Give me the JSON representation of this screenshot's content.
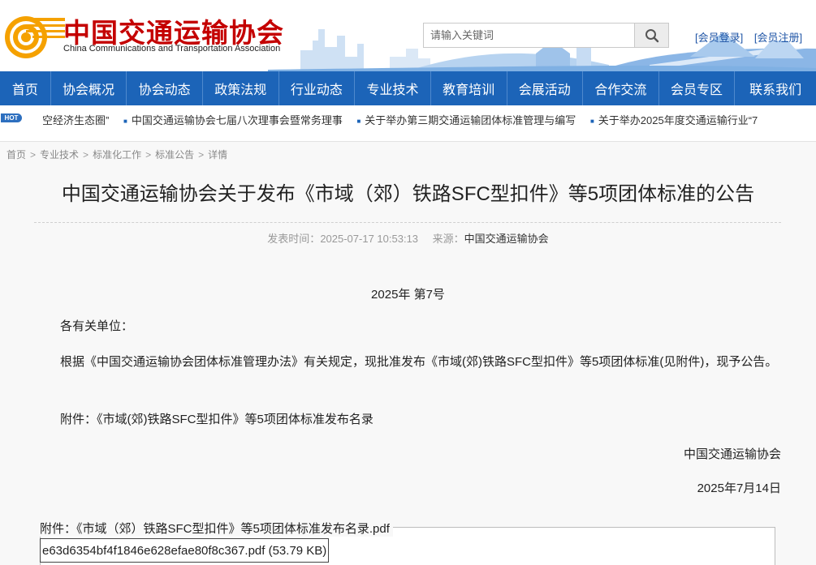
{
  "header": {
    "logo_cn": "中国交通运输协会",
    "logo_en": "China Communications and Transportation Association",
    "search_placeholder": "请输入关键词",
    "member_login": "[会员登录]",
    "member_register": "[会员注册]"
  },
  "nav": {
    "items": [
      {
        "label": "首页"
      },
      {
        "label": "协会概况"
      },
      {
        "label": "协会动态"
      },
      {
        "label": "政策法规"
      },
      {
        "label": "行业动态"
      },
      {
        "label": "专业技术"
      },
      {
        "label": "教育培训"
      },
      {
        "label": "会展活动"
      },
      {
        "label": "合作交流"
      },
      {
        "label": "会员专区"
      },
      {
        "label": "联系我们"
      }
    ]
  },
  "ticker": {
    "badge": "HOT",
    "items": [
      {
        "text": "空经济生态圈”"
      },
      {
        "text": "中国交通运输协会七届八次理事会暨常务理事"
      },
      {
        "text": "关于举办第三期交通运输团体标准管理与编写"
      },
      {
        "text": "关于举办2025年度交通运输行业“7"
      }
    ]
  },
  "breadcrumb": {
    "items": [
      "首页",
      "专业技术",
      "标准化工作",
      "标准公告",
      "详情"
    ],
    "separator": ">"
  },
  "article": {
    "title": "中国交通运输协会关于发布《市域（郊）铁路SFC型扣件》等5项团体标准的公告",
    "publish_label": "发表时间：",
    "publish_time": "2025-07-17 10:53:13",
    "source_label": "来源：",
    "source": "中国交通运输协会",
    "doc_number": "2025年 第7号",
    "greeting": "各有关单位：",
    "body": "根据《中国交通运输协会团体标准管理办法》有关规定，现批准发布《市域(郊)铁路SFC型扣件》等5项团体标准(见附件)，现予公告。",
    "attachment_note": "附件：《市域(郊)铁路SFC型扣件》等5项团体标准发布名录",
    "signer": "中国交通运输协会",
    "date": "2025年7月14日"
  },
  "attachment": {
    "legend": "附件：《市域（郊）铁路SFC型扣件》等5项团体标准发布名录.pdf",
    "file": "e63d6354bf4f1846e628efae80f8c367.pdf (53.79 KB)"
  },
  "colors": {
    "nav_bg": "#1c64b8",
    "logo_red": "#c40000",
    "link_blue": "#1f55a6",
    "logo_orange": "#f5a100"
  }
}
